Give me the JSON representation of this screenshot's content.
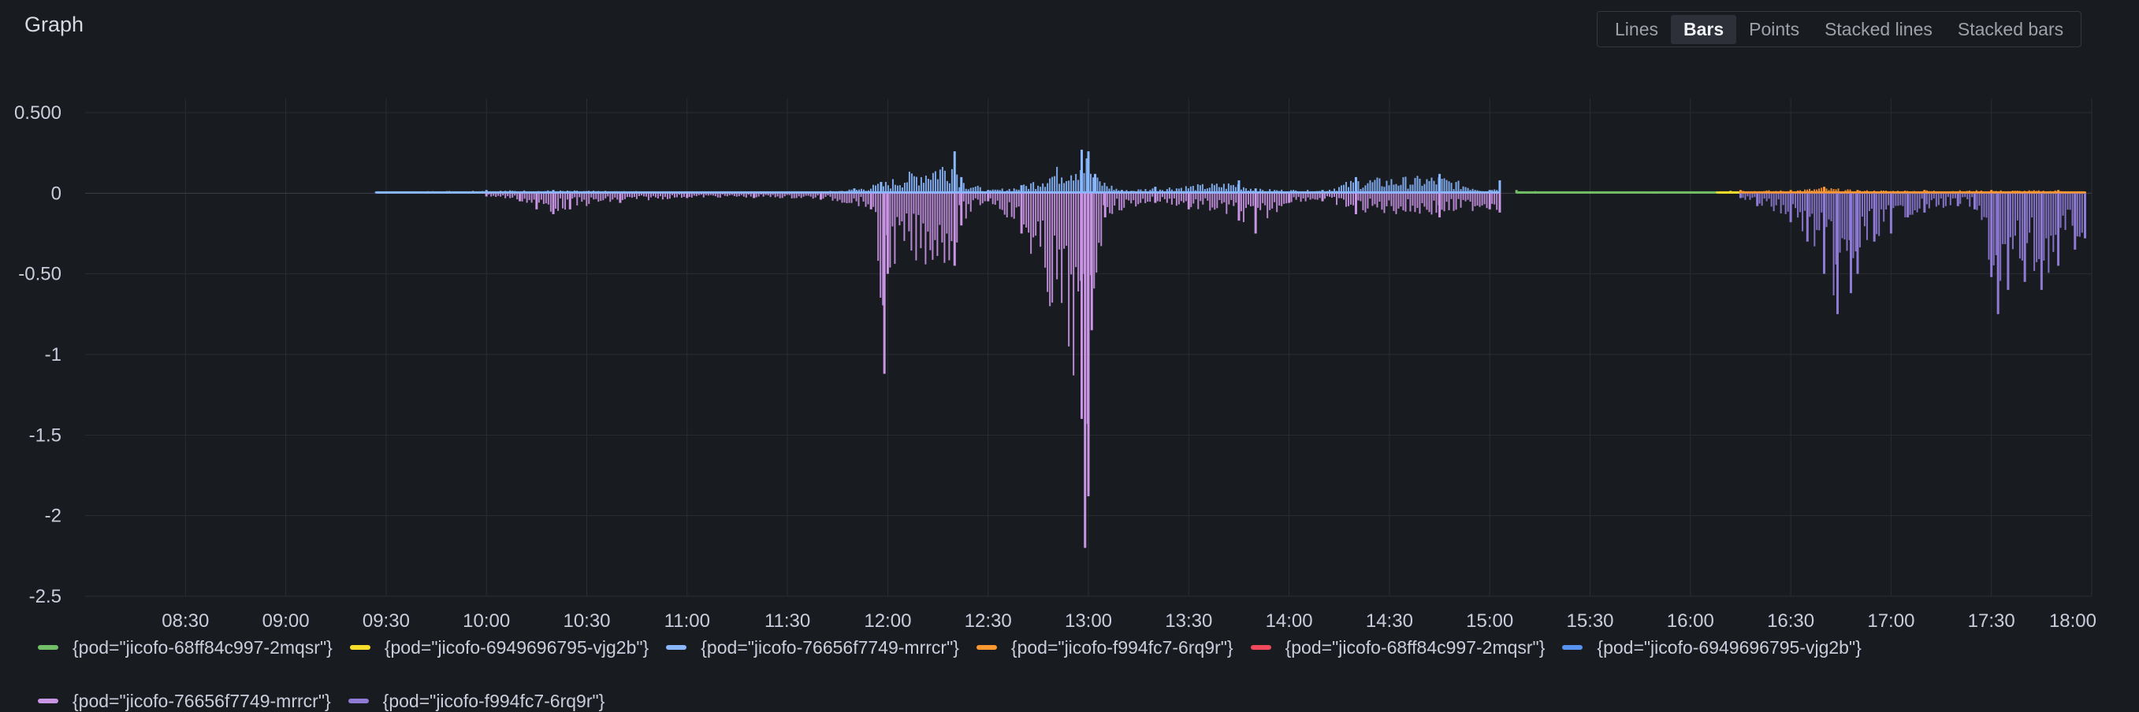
{
  "panel": {
    "title": "Graph"
  },
  "view_modes": [
    {
      "label": "Lines",
      "active": false
    },
    {
      "label": "Bars",
      "active": true
    },
    {
      "label": "Points",
      "active": false
    },
    {
      "label": "Stacked lines",
      "active": false
    },
    {
      "label": "Stacked bars",
      "active": false
    }
  ],
  "chart_data": {
    "type": "bar",
    "ylim": [
      -2.5,
      0.5
    ],
    "y_ticks": [
      {
        "value": 0.5,
        "label": "0.500"
      },
      {
        "value": 0,
        "label": "0"
      },
      {
        "value": -0.5,
        "label": "-0.50"
      },
      {
        "value": -1,
        "label": "-1"
      },
      {
        "value": -1.5,
        "label": "-1.5"
      },
      {
        "value": -2,
        "label": "-2"
      },
      {
        "value": -2.5,
        "label": "-2.5"
      }
    ],
    "x_range": [
      "08:00",
      "18:00"
    ],
    "x_ticks": [
      "08:30",
      "09:00",
      "09:30",
      "10:00",
      "10:30",
      "11:00",
      "11:30",
      "12:00",
      "12:30",
      "13:00",
      "13:30",
      "14:00",
      "14:30",
      "15:00",
      "15:30",
      "16:00",
      "16:30",
      "17:00",
      "17:30",
      "18:00"
    ],
    "grid": true,
    "legend_position": "bottom",
    "series": [
      {
        "name": "{pod=\"jicofo-68ff84c997-2mqsr\"}",
        "color": "#73bf69",
        "sign": "positive",
        "points": [
          [
            "15:08",
            0.02
          ],
          [
            "15:20",
            0.01
          ],
          [
            "15:40",
            0.01
          ],
          [
            "16:00",
            0.01
          ],
          [
            "16:08",
            0.01
          ]
        ]
      },
      {
        "name": "{pod=\"jicofo-6949696795-vjg2b\"}",
        "color": "#fade2a",
        "sign": "positive",
        "points": [
          [
            "16:08",
            0.01
          ],
          [
            "16:12",
            0.015
          ],
          [
            "16:15",
            0.01
          ]
        ]
      },
      {
        "name": "{pod=\"jicofo-76656f7749-mrrcr\"}",
        "color": "#8ab8ff",
        "sign": "positive",
        "points": [
          [
            "09:27",
            0.01
          ],
          [
            "10:00",
            0.02
          ],
          [
            "10:20",
            0.02
          ],
          [
            "11:00",
            0.01
          ],
          [
            "11:40",
            0.01
          ],
          [
            "11:50",
            0.03
          ],
          [
            "11:58",
            0.07
          ],
          [
            "12:20",
            0.26
          ],
          [
            "12:22",
            0.1
          ],
          [
            "12:30",
            0.02
          ],
          [
            "12:40",
            0.05
          ],
          [
            "12:58",
            0.27
          ],
          [
            "13:00",
            0.26
          ],
          [
            "13:02",
            0.12
          ],
          [
            "13:10",
            0.02
          ],
          [
            "13:20",
            0.04
          ],
          [
            "13:45",
            0.08
          ],
          [
            "13:50",
            0.03
          ],
          [
            "14:10",
            0.02
          ],
          [
            "14:20",
            0.1
          ],
          [
            "14:45",
            0.12
          ],
          [
            "15:00",
            0.02
          ],
          [
            "15:03",
            0.08
          ]
        ]
      },
      {
        "name": "{pod=\"jicofo-f994fc7-6rq9r\"}",
        "color": "#ff9830",
        "sign": "positive",
        "points": [
          [
            "16:15",
            0.02
          ],
          [
            "16:30",
            0.02
          ],
          [
            "16:40",
            0.04
          ],
          [
            "16:50",
            0.02
          ],
          [
            "17:10",
            0.02
          ],
          [
            "17:30",
            0.02
          ],
          [
            "17:50",
            0.02
          ],
          [
            "17:58",
            0.01
          ]
        ]
      },
      {
        "name": "{pod=\"jicofo-68ff84c997-2mqsr\"}",
        "color": "#f2495c",
        "sign": "negative",
        "points": []
      },
      {
        "name": "{pod=\"jicofo-6949696795-vjg2b\"}",
        "color": "#5794f2",
        "sign": "negative",
        "points": []
      },
      {
        "name": "{pod=\"jicofo-76656f7749-mrrcr\"}",
        "color": "#ca95e5",
        "sign": "negative",
        "points": [
          [
            "10:00",
            -0.02
          ],
          [
            "10:10",
            -0.05
          ],
          [
            "10:15",
            -0.1
          ],
          [
            "10:20",
            -0.13
          ],
          [
            "10:25",
            -0.1
          ],
          [
            "10:40",
            -0.06
          ],
          [
            "11:00",
            -0.03
          ],
          [
            "11:20",
            -0.03
          ],
          [
            "11:40",
            -0.04
          ],
          [
            "11:55",
            -0.1
          ],
          [
            "11:59",
            -1.12
          ],
          [
            "12:00",
            -0.5
          ],
          [
            "12:20",
            -0.45
          ],
          [
            "12:22",
            -0.2
          ],
          [
            "12:30",
            -0.05
          ],
          [
            "12:40",
            -0.25
          ],
          [
            "12:58",
            -1.4
          ],
          [
            "12:59",
            -2.2
          ],
          [
            "13:00",
            -1.88
          ],
          [
            "13:01",
            -0.85
          ],
          [
            "13:05",
            -0.15
          ],
          [
            "13:20",
            -0.06
          ],
          [
            "13:30",
            -0.1
          ],
          [
            "13:45",
            -0.17
          ],
          [
            "13:50",
            -0.25
          ],
          [
            "14:00",
            -0.06
          ],
          [
            "14:10",
            -0.05
          ],
          [
            "14:20",
            -0.13
          ],
          [
            "14:45",
            -0.15
          ],
          [
            "15:00",
            -0.1
          ],
          [
            "15:03",
            -0.12
          ]
        ]
      },
      {
        "name": "{pod=\"jicofo-f994fc7-6rq9r\"}",
        "color": "#8f7bd6",
        "sign": "negative",
        "points": [
          [
            "16:15",
            -0.03
          ],
          [
            "16:20",
            -0.08
          ],
          [
            "16:30",
            -0.18
          ],
          [
            "16:35",
            -0.3
          ],
          [
            "16:40",
            -0.5
          ],
          [
            "16:44",
            -0.75
          ],
          [
            "16:48",
            -0.62
          ],
          [
            "16:50",
            -0.5
          ],
          [
            "16:55",
            -0.3
          ],
          [
            "17:00",
            -0.25
          ],
          [
            "17:05",
            -0.15
          ],
          [
            "17:10",
            -0.12
          ],
          [
            "17:20",
            -0.08
          ],
          [
            "17:25",
            -0.1
          ],
          [
            "17:30",
            -0.52
          ],
          [
            "17:32",
            -0.75
          ],
          [
            "17:35",
            -0.6
          ],
          [
            "17:40",
            -0.55
          ],
          [
            "17:45",
            -0.6
          ],
          [
            "17:50",
            -0.45
          ],
          [
            "17:55",
            -0.35
          ],
          [
            "17:58",
            -0.28
          ]
        ]
      }
    ]
  }
}
